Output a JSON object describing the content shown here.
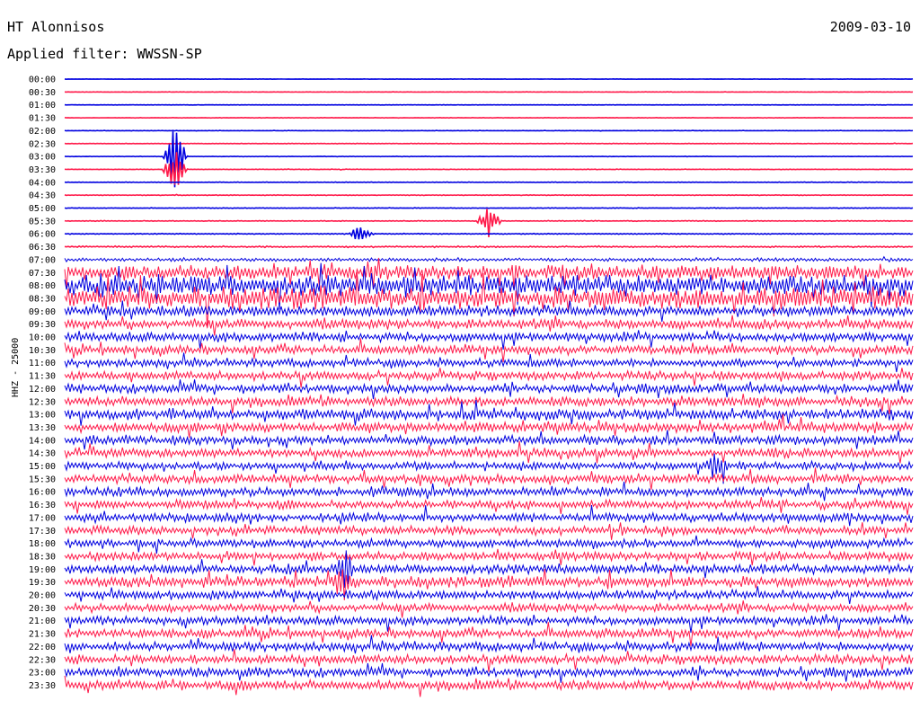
{
  "header": {
    "station": "HT Alonnisos",
    "date": "2009-03-10",
    "filter": "Applied filter: WWSSN-SP"
  },
  "chart_data": {
    "type": "line",
    "title": "HT Alonnisos",
    "ylabel": "HHZ - 25000",
    "tick_labels": [
      "00:00",
      "00:30",
      "01:00",
      "01:30",
      "02:00",
      "02:30",
      "03:00",
      "03:30",
      "04:00",
      "04:30",
      "05:00",
      "05:30",
      "06:00",
      "06:30",
      "07:00",
      "07:30",
      "08:00",
      "08:30",
      "09:00",
      "09:30",
      "10:00",
      "10:30",
      "11:00",
      "11:30",
      "12:00",
      "12:30",
      "13:00",
      "13:30",
      "14:00",
      "14:30",
      "15:00",
      "15:30",
      "16:00",
      "16:30",
      "17:00",
      "17:30",
      "18:00",
      "18:30",
      "19:00",
      "19:30",
      "20:00",
      "20:30",
      "21:00",
      "21:30",
      "22:00",
      "22:30",
      "23:00",
      "23:30"
    ],
    "colors": [
      "#0000e0",
      "#ff1a4a"
    ],
    "activity_levels": [
      0.04,
      0.04,
      0.04,
      0.05,
      0.05,
      0.05,
      0.05,
      0.06,
      0.06,
      0.07,
      0.07,
      0.08,
      0.1,
      0.15,
      0.4,
      1.6,
      2.2,
      2.4,
      1.2,
      1.1,
      1.0,
      1.0,
      0.9,
      0.95,
      1.0,
      1.1,
      1.2,
      1.1,
      1.0,
      1.0,
      0.9,
      0.95,
      1.0,
      0.95,
      1.0,
      0.95,
      0.95,
      0.95,
      1.0,
      1.2,
      1.0,
      0.95,
      0.95,
      1.0,
      1.0,
      1.0,
      1.0,
      1.1
    ],
    "events": [
      {
        "row": 6,
        "pos": 0.13,
        "amp": 3.0
      },
      {
        "row": 7,
        "pos": 0.13,
        "amp": 2.0
      },
      {
        "row": 11,
        "pos": 0.5,
        "amp": 1.5
      },
      {
        "row": 12,
        "pos": 0.35,
        "amp": 1.0
      },
      {
        "row": 30,
        "pos": 0.77,
        "amp": 1.5
      },
      {
        "row": 38,
        "pos": 0.33,
        "amp": 1.5
      },
      {
        "row": 39,
        "pos": 0.33,
        "amp": 1.5
      }
    ],
    "grid": false,
    "legend": "none"
  }
}
